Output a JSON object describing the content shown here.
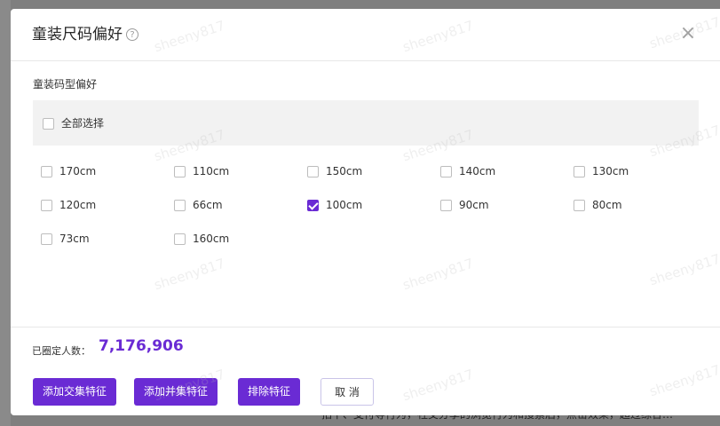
{
  "dialog": {
    "title": "童装尺码偏好",
    "help_icon": "?",
    "close_icon": "×",
    "section_label": "童装码型偏好",
    "select_all": {
      "label": "全部选择",
      "checked": false
    },
    "sizes": [
      {
        "label": "170cm",
        "checked": false
      },
      {
        "label": "110cm",
        "checked": false
      },
      {
        "label": "150cm",
        "checked": false
      },
      {
        "label": "140cm",
        "checked": false
      },
      {
        "label": "130cm",
        "checked": false
      },
      {
        "label": "120cm",
        "checked": false
      },
      {
        "label": "66cm",
        "checked": false
      },
      {
        "label": "100cm",
        "checked": true
      },
      {
        "label": "90cm",
        "checked": false
      },
      {
        "label": "80cm",
        "checked": false
      },
      {
        "label": "73cm",
        "checked": false
      },
      {
        "label": "160cm",
        "checked": false
      }
    ],
    "count_label": "已圈定人数：",
    "count_value": "7,176,906",
    "buttons": {
      "add_intersection": "添加交集特征",
      "add_union": "添加并集特征",
      "exclude": "排除特征",
      "cancel": "取 消"
    }
  },
  "watermark_text": "sheeny817",
  "background_text": "拍下、支付等行为，社交分享的浏览行为和搜索后，点击效果，超过综合…",
  "colors": {
    "accent": "#6a2bd4",
    "overlay": "#7f7f7f"
  }
}
